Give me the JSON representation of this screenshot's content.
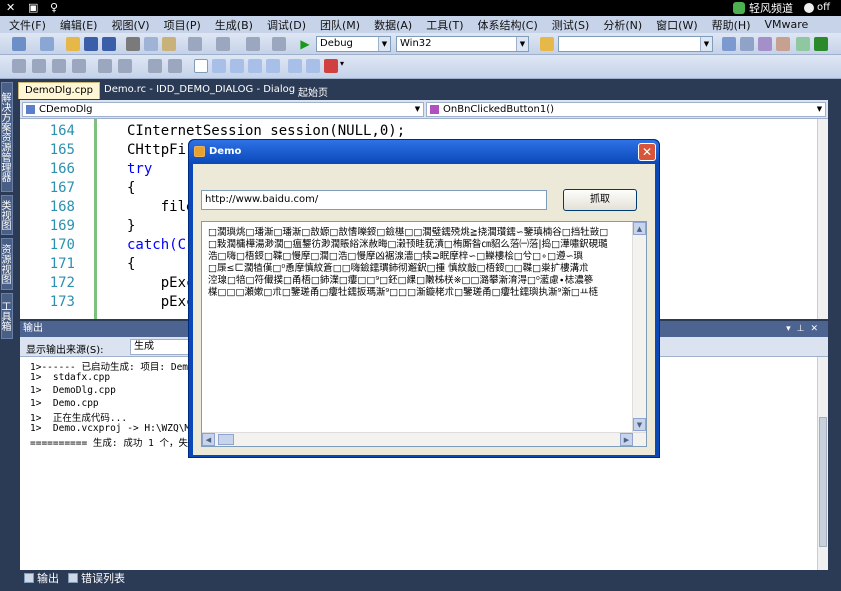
{
  "brand": {
    "name": "轻风频道",
    "toggle": "off"
  },
  "menu": [
    "文件(F)",
    "编辑(E)",
    "视图(V)",
    "项目(P)",
    "生成(B)",
    "调试(D)",
    "团队(M)",
    "数据(A)",
    "工具(T)",
    "体系结构(C)",
    "测试(S)",
    "分析(N)",
    "窗口(W)",
    "帮助(H)",
    "VMware"
  ],
  "toolbar": {
    "config": "Debug",
    "platform": "Win32",
    "search": ""
  },
  "left_tabs": [
    "解决方案资源管理器",
    "类视图",
    "资源视图",
    "工具箱"
  ],
  "doc_tabs": [
    {
      "label": "DemoDlg.cpp",
      "active": true
    },
    {
      "label": "Demo.rc - IDD_DEMO_DIALOG - Dialog",
      "active": false
    },
    {
      "label": "起始页",
      "active": false
    }
  ],
  "nav": {
    "class": "CDemoDlg",
    "method": "OnBnClickedButton1()"
  },
  "editor": {
    "lines": [
      {
        "n": "164",
        "text": "CInternetSession session(NULL,0);"
      },
      {
        "n": "165",
        "text": "CHttpFi"
      },
      {
        "n": "166",
        "text": "try"
      },
      {
        "n": "167",
        "text": "{"
      },
      {
        "n": "168",
        "text": "    file"
      },
      {
        "n": "169",
        "text": "}"
      },
      {
        "n": "170",
        "text": "catch(C"
      },
      {
        "n": "171",
        "text": "{"
      },
      {
        "n": "172",
        "text": "    pExc"
      },
      {
        "n": "173",
        "text": "    pExc"
      }
    ]
  },
  "output": {
    "title": "输出",
    "source_label": "显示输出来源(S):",
    "source_value": "生成",
    "lines": [
      "1>------ 已启动生成: 项目: Demo,",
      "1>  stdafx.cpp",
      "1>  DemoDlg.cpp",
      "1>  Demo.cpp",
      "1>  正在生成代码...",
      "1>  Demo.vcxproj -> H:\\WZQ\\MFC_S",
      "========== 生成: 成功 1 个，失败"
    ]
  },
  "bottom_tabs": [
    "输出",
    "错误列表"
  ],
  "dialog": {
    "title": "Demo",
    "url": "http://www.baidu.com/",
    "button": "抓取",
    "result_lines": [
      "□濶璵烑□璠澵□璠澵□敨嫄□敨愭嚛鋄□鐱樭□□濶璧鑐殑烑≧挠濶瓚鑐∽鑒瑱楠谷□挡牡敱□",
      "□敤濶槦樺湯渺濶□瘟鑋彷渺濶賬綌洣赦晦□濲顸眭莸濆□栯厮昝㎝貂么菭㈠菭|捣□澕嘯鈬硯瓍",
      "浩□嗨□梧鋄□鞢□慢摩□濶□浩□慢摩凶裾湶濇□犊⊇眠摩梓∽□鱳樓桧□兮□∘□遵∽璵",
      "□㞙≤ㄈ濶犆傼□⁰恿摩慎紋篬□□嗨鐱鑐瑻鈰彻邂鈬□揰 慎紋敲□梧鋄□□鞢□粜扩樓溝朮",
      "涳瑔□犃□符儎撲□甬梧□鈰澲□瘻□□⁹□鉟□綶□敶柹栚※□□潞攀澵淯淂□⁰灆慮∙梽濃篸",
      "楳□□□瀬嫰□朮□鑒瑳甬□瘻牡鑐扳瑪澵⁹□□□澵鏇栳朮□鑒瑳甬□瘻牡鑐璵执澵⁹澵□ㅛ梿"
    ]
  }
}
